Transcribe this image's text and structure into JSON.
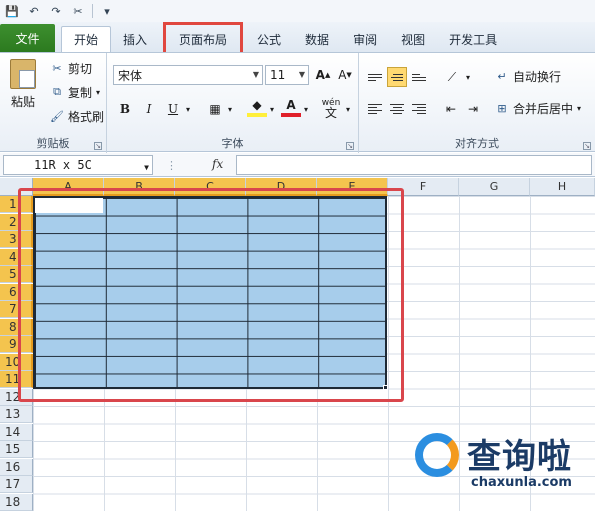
{
  "qat": {
    "save_icon": "save-icon",
    "undo_icon": "undo-icon",
    "redo_icon": "redo-icon",
    "tools_icon": "tools-icon"
  },
  "tabs": [
    {
      "label": "文件"
    },
    {
      "label": "开始"
    },
    {
      "label": "插入"
    },
    {
      "label": "页面布局"
    },
    {
      "label": "公式"
    },
    {
      "label": "数据"
    },
    {
      "label": "审阅"
    },
    {
      "label": "视图"
    },
    {
      "label": "开发工具"
    }
  ],
  "clipboard": {
    "paste": "粘贴",
    "cut": "剪切",
    "copy": "复制",
    "format_painter": "格式刷",
    "label": "剪贴板"
  },
  "font": {
    "name": "宋体",
    "size": "11",
    "label": "字体",
    "bold": "B",
    "italic": "I",
    "underline": "U",
    "wen": "wén"
  },
  "alignment": {
    "wrap_text": "自动换行",
    "merge_center": "合并后居中",
    "label": "对齐方式"
  },
  "formula_bar": {
    "name_box": "11R x 5C",
    "fx": "fx",
    "formula": ""
  },
  "grid": {
    "columns": [
      "A",
      "B",
      "C",
      "D",
      "E",
      "F",
      "G",
      "H"
    ],
    "rows": [
      "1",
      "2",
      "3",
      "4",
      "5",
      "6",
      "7",
      "8",
      "9",
      "10",
      "11",
      "12",
      "13",
      "14",
      "15",
      "16",
      "17",
      "18"
    ]
  },
  "watermark": {
    "title": "查询啦",
    "url": "chaxunla.com"
  },
  "colors": {
    "selection": "#a7cdeb",
    "header_selected": "#f4c44e",
    "highlight": "#d9464c",
    "file_tab": "#2c7a1f"
  }
}
